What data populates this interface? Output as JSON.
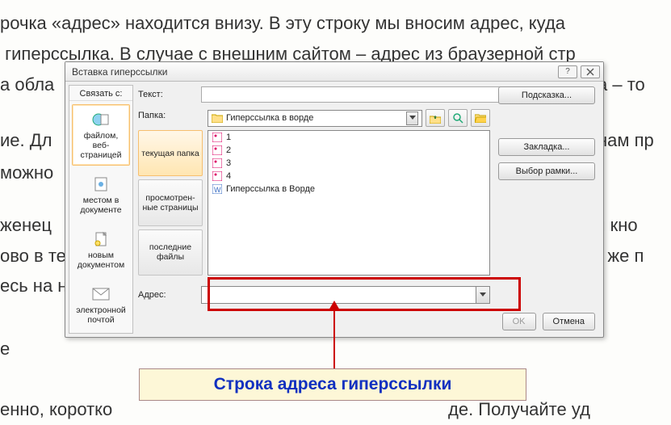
{
  "bg": {
    "l1": "рочка «адрес» находится внизу. В эту строку мы вносим адрес, куда",
    "l2": " гиперссылка. В случае с внешним сайтом – адрес из браузерной стр",
    "l3l": "а обла",
    "l3r": "а – то",
    "l4l": "ие. Дл",
    "l4r": "нам пр",
    "l5": "можно",
    "l6l": "женец",
    "l6r": "ой кно",
    "l7l": "ово в те",
    "l7r": "ту же п",
    "l8": "есь на н",
    "l9": "е",
    "l10l": "енно, коротко",
    "l10r": "де. Получайте уд"
  },
  "dialog": {
    "title": "Вставка гиперссылки",
    "text_label": "Текст:",
    "hint_btn": "Подсказка...",
    "link_with": "Связать с:",
    "left_items": [
      {
        "label": "файлом, веб-страницей",
        "selected": true
      },
      {
        "label": "местом в документе",
        "selected": false
      },
      {
        "label": "новым документом",
        "selected": false
      },
      {
        "label": "электронной почтой",
        "selected": false
      }
    ],
    "mid_items": [
      {
        "label": "текущая папка",
        "selected": true
      },
      {
        "label": "просмотрен-ные страницы",
        "selected": false
      },
      {
        "label": "последние файлы",
        "selected": false
      }
    ],
    "folder_label": "Папка:",
    "folder_value": "Гиперссылка в ворде",
    "right_btns": {
      "bookmark": "Закладка...",
      "frame": "Выбор рамки..."
    },
    "files": [
      "1",
      "2",
      "3",
      "4",
      "Гиперссылка в Ворде"
    ],
    "addr_label": "Адрес:",
    "ok": "OK",
    "cancel": "Отмена"
  },
  "callout": "Строка адреса гиперссылки"
}
